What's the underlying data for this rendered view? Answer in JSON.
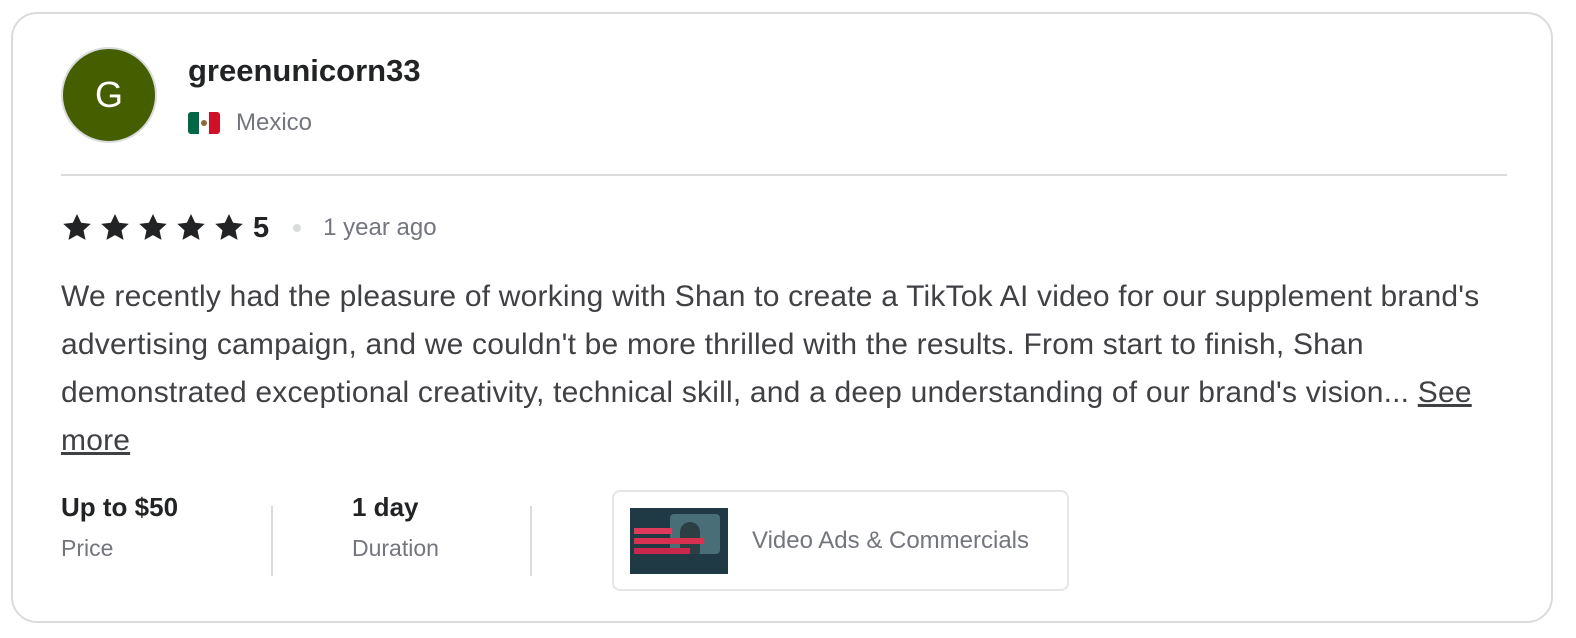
{
  "reviewer": {
    "avatar_initial": "G",
    "avatar_color": "#455e00",
    "username": "greenunicorn33",
    "country": "Mexico",
    "flag_icon": "mexico-flag-icon"
  },
  "rating": {
    "stars": 5,
    "value": "5",
    "time_ago": "1 year ago"
  },
  "review": {
    "text": "We recently had the pleasure of working with Shan to create a TikTok AI video for our supplement brand's advertising campaign, and we couldn't be more thrilled with the results. From start to finish, Shan demonstrated exceptional creativity, technical skill, and a deep understanding of our brand's vision...",
    "see_more_label": "See more"
  },
  "details": {
    "price_value": "Up to $50",
    "price_label": "Price",
    "duration_value": "1 day",
    "duration_label": "Duration"
  },
  "gig": {
    "category": "Video Ads & Commercials",
    "thumbnail_icon": "gig-thumbnail-image"
  }
}
